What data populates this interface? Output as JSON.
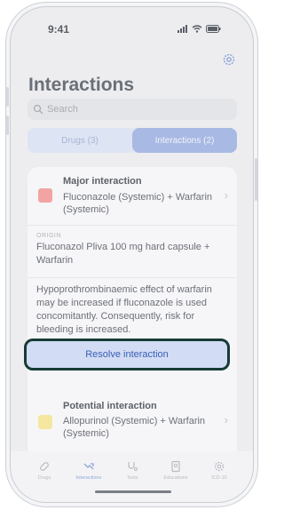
{
  "status": {
    "time": "9:41"
  },
  "page": {
    "title": "Interactions"
  },
  "search": {
    "placeholder": "Search"
  },
  "tabs": {
    "drugs": "Drugs (3)",
    "interactions": "Interactions (2)"
  },
  "interaction1": {
    "severity": "Major interaction",
    "severity_color": "#f2a4a4",
    "drugs": "Fluconazole (Systemic) + Warfarin (Systemic)",
    "origin_label": "ORIGIN",
    "origin": "Fluconazol Pliva 100 mg hard capsule + Warfarin",
    "effect": "Hypoprothrombinaemic effect of warfarin may be increased if fluconazole is used concomitantly. Consequently, risk for bleeding is increased.",
    "resolve_label": "Resolve interaction"
  },
  "interaction2": {
    "severity": "Potential interaction",
    "severity_color": "#f5e7a0",
    "drugs": "Allopurinol (Systemic) + Warfarin (Systemic)"
  },
  "tabbar": {
    "items": [
      {
        "label": "Drugs",
        "icon": "pill-icon"
      },
      {
        "label": "Interactions",
        "icon": "interactions-icon",
        "active": true
      },
      {
        "label": "Tests",
        "icon": "stethoscope-icon"
      },
      {
        "label": "Educations",
        "icon": "education-icon"
      },
      {
        "label": "ICD-10",
        "icon": "icd-icon"
      }
    ]
  },
  "colors": {
    "accent": "#8ea6da",
    "resolve_border": "#173b36"
  }
}
